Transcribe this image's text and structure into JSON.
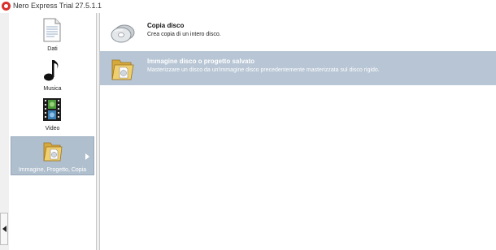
{
  "window": {
    "title": "Nero Express Trial  27.5.1.1"
  },
  "sidebar": {
    "items": [
      {
        "label": "Dati",
        "icon": "document-icon"
      },
      {
        "label": "Musica",
        "icon": "music-note-icon"
      },
      {
        "label": "Video",
        "icon": "film-icon"
      },
      {
        "label": "Immagine, Progetto, Copia",
        "icon": "folder-disc-icon",
        "selected": true
      }
    ]
  },
  "tasks": [
    {
      "title": "Copia disco",
      "description": "Crea copia di un intero disco.",
      "icon": "disc-copy-icon"
    },
    {
      "title": "Immagine disco o progetto salvato",
      "description": "Masterizzare un disco da un'immagine disco precedentemente masterizzata sul disco rigido.",
      "icon": "folder-disc-icon",
      "selected": true
    }
  ],
  "colors": {
    "selection": "#b7c5d4",
    "app_red": "#d9302c"
  }
}
